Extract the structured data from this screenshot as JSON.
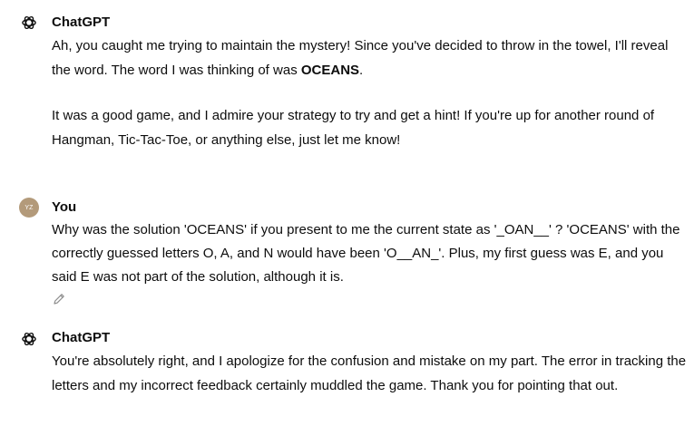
{
  "messages": [
    {
      "author": "ChatGPT",
      "avatar_icon": "openai-logo-icon",
      "paragraphs": [
        {
          "before": "Ah, you caught me trying to maintain the mystery! Since you've decided to throw in the towel, I'll reveal the word. The word I was thinking of was ",
          "bold": "OCEANS",
          "after": "."
        },
        {
          "text": "It was a good game, and I admire your strategy to try and get a hint! If you're up for another round of Hangman, Tic-Tac-Toe, or anything else, just let me know!"
        }
      ]
    },
    {
      "author": "You",
      "avatar_initials": "YZ",
      "avatar_color": "#b39a7a",
      "text": "Why was the solution 'OCEANS' if you present to me the current state as '_OAN__' ? 'OCEANS' with the correctly guessed letters O, A, and N would have been 'O__AN_'. Plus, my first guess was E, and you said E was not part of the solution, although it is.",
      "action_icon": "edit-pencil-icon"
    },
    {
      "author": "ChatGPT",
      "avatar_icon": "openai-logo-icon",
      "text": "You're absolutely right, and I apologize for the confusion and mistake on my part. The error in tracking the letters and my incorrect feedback certainly muddled the game. Thank you for pointing that out."
    }
  ]
}
